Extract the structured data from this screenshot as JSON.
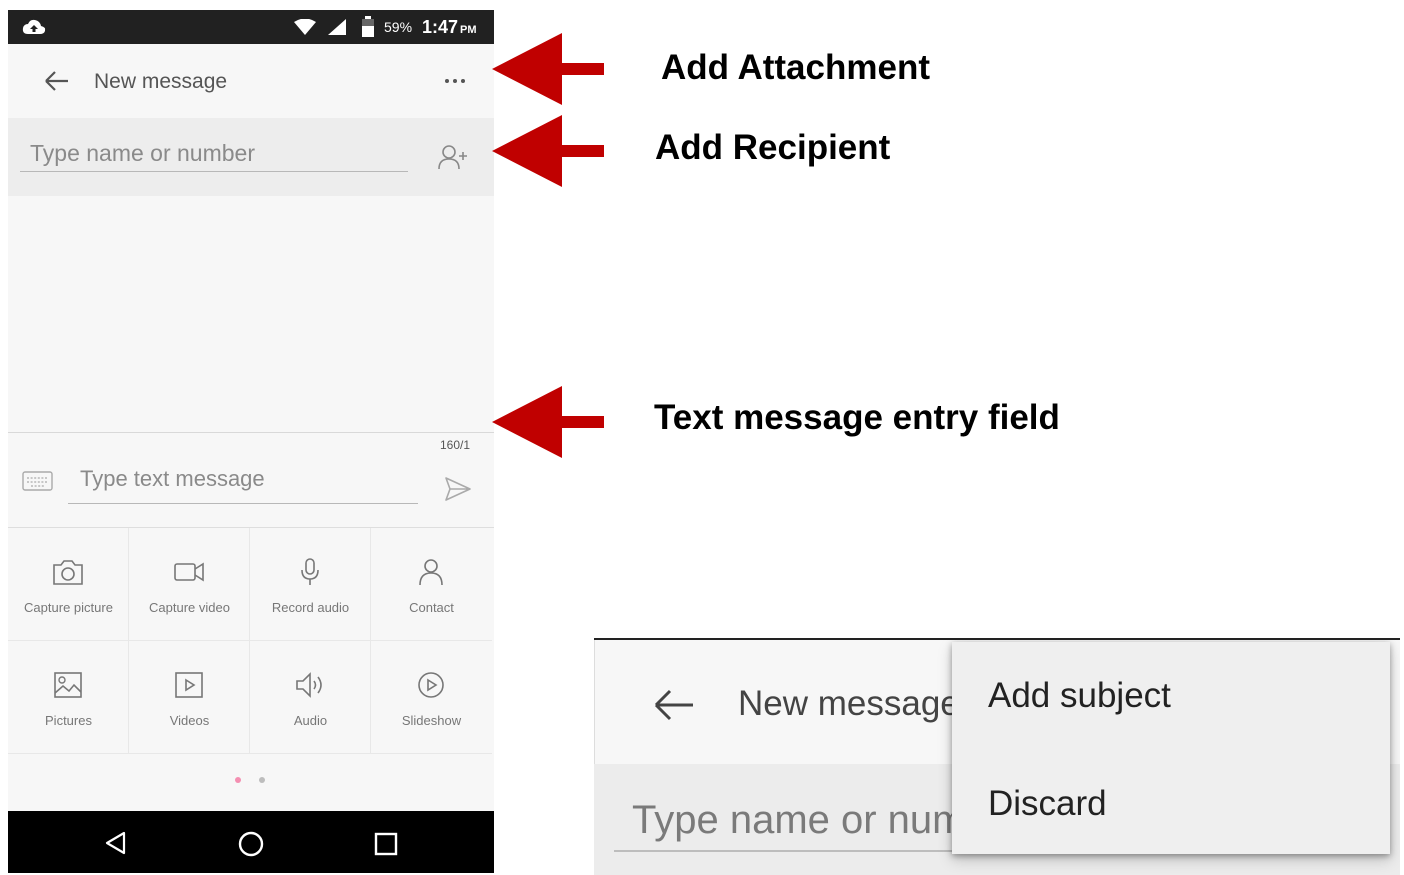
{
  "phone": {
    "status": {
      "battery": "59%",
      "time": "1:47",
      "ampm": "PM"
    },
    "appbar": {
      "title": "New message"
    },
    "recipient": {
      "placeholder": "Type name or number"
    },
    "compose": {
      "counter": "160/1",
      "placeholder": "Type text message"
    },
    "attachments": [
      {
        "label": "Capture picture",
        "icon": "camera-icon"
      },
      {
        "label": "Capture video",
        "icon": "video-camera-icon"
      },
      {
        "label": "Record audio",
        "icon": "microphone-icon"
      },
      {
        "label": "Contact",
        "icon": "person-icon"
      },
      {
        "label": "Pictures",
        "icon": "image-icon"
      },
      {
        "label": "Videos",
        "icon": "video-file-icon"
      },
      {
        "label": "Audio",
        "icon": "speaker-icon"
      },
      {
        "label": "Slideshow",
        "icon": "play-circle-icon"
      }
    ],
    "page_indicator": {
      "pages": 2,
      "active": 1
    }
  },
  "annotations": {
    "add_attachment": "Add Attachment",
    "add_recipient": "Add Recipient",
    "text_entry": "Text message entry field"
  },
  "inset": {
    "title": "New message",
    "recipient_placeholder": "Type name or num",
    "menu": [
      "Add subject",
      "Discard"
    ]
  },
  "colors": {
    "arrow": "#c00000",
    "statusbar": "#212121",
    "navbar": "#000000",
    "active_dot": "#f48fb1"
  }
}
